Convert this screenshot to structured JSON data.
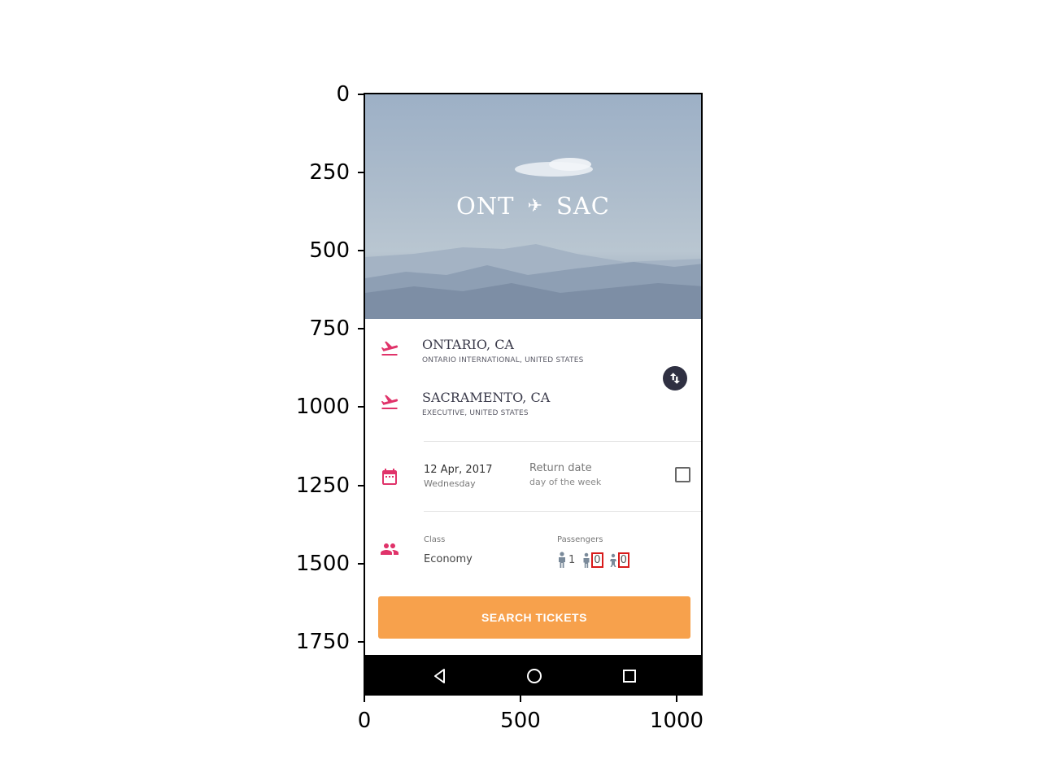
{
  "axes": {
    "y_ticks": [
      "0",
      "250",
      "500",
      "750",
      "1000",
      "1250",
      "1500",
      "1750"
    ],
    "x_ticks": [
      "0",
      "500",
      "1000"
    ]
  },
  "hero": {
    "origin_code": "ONT",
    "plane_glyph": "✈",
    "destination_code": "SAC"
  },
  "origin": {
    "city": "ONTARIO, CA",
    "airport": "ONTARIO INTERNATIONAL, UNITED STATES",
    "icon": "takeoff-icon"
  },
  "destination": {
    "city": "SACRAMENTO, CA",
    "airport": "EXECUTIVE, UNITED STATES",
    "icon": "landing-icon"
  },
  "swap": {
    "icon": "swap-vertical-icon"
  },
  "dates": {
    "icon": "calendar-icon",
    "departure": "12 Apr, 2017",
    "departure_weekday": "Wednesday",
    "return_label": "Return date",
    "return_sub": "day of the week",
    "return_enabled": false
  },
  "travel": {
    "icon": "people-icon",
    "class_label": "Class",
    "class_value": "Economy",
    "passengers_label": "Passengers",
    "adults": "1",
    "children": "0",
    "infants": "0"
  },
  "search_button": "SEARCH TICKETS",
  "nav": [
    "back-icon",
    "home-icon",
    "recents-icon"
  ],
  "colors": {
    "accent": "#e0336a",
    "button": "#f7a14c",
    "swap_button": "#2f3042",
    "highlight_box": "#d81b1b"
  }
}
